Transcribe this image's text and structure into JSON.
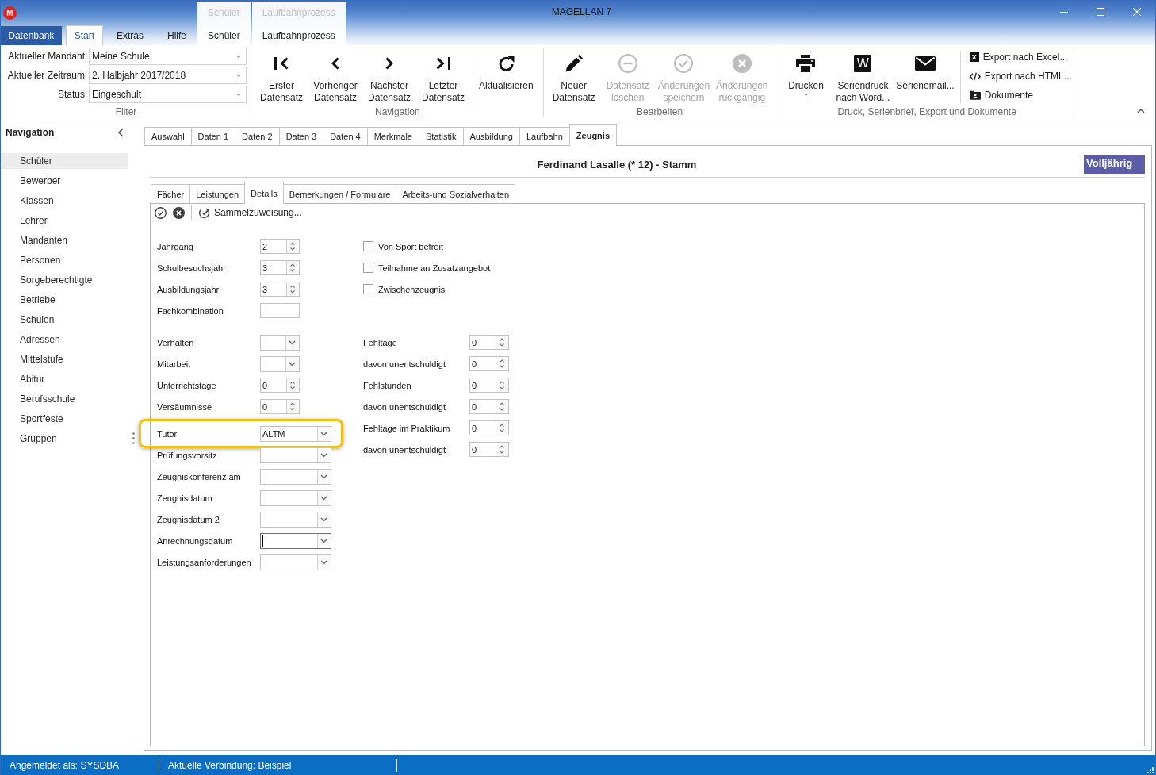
{
  "window": {
    "title": "MAGELLAN 7",
    "logo_letter": "M"
  },
  "ribbon": {
    "file_button": "Datenbank",
    "tabs": [
      {
        "label": "Start",
        "selected": true
      },
      {
        "label": "Extras",
        "selected": false
      },
      {
        "label": "Hilfe",
        "selected": false
      }
    ],
    "context_groups": [
      {
        "header": "Schüler",
        "tabs": [
          {
            "label": "Schüler",
            "selected": false
          }
        ]
      },
      {
        "header": "Laufbahnprozess",
        "tabs": [
          {
            "label": "Laufbahnprozess",
            "selected": false
          }
        ]
      }
    ],
    "filter": {
      "label": "Filter",
      "fields": [
        {
          "label": "Aktueller Mandant",
          "value": "Meine Schule"
        },
        {
          "label": "Aktueller Zeitraum",
          "value": "2. Halbjahr 2017/2018"
        },
        {
          "label": "Status",
          "value": "Eingeschult"
        }
      ]
    },
    "groups": [
      {
        "label": "Navigation",
        "sections": [
          [
            {
              "kind": "large",
              "lines": [
                "Erster",
                "Datensatz"
              ],
              "disabled": false,
              "dropdown": false
            },
            {
              "kind": "large",
              "lines": [
                "Vorheriger",
                "Datensatz"
              ],
              "disabled": false,
              "dropdown": false
            },
            {
              "kind": "large",
              "lines": [
                "Nächster",
                "Datensatz"
              ],
              "disabled": false,
              "dropdown": false
            },
            {
              "kind": "large",
              "lines": [
                "Letzter",
                "Datensatz"
              ],
              "disabled": false,
              "dropdown": false
            }
          ],
          [
            {
              "kind": "large",
              "lines": [
                "Aktualisieren"
              ],
              "disabled": false,
              "dropdown": false
            }
          ]
        ]
      },
      {
        "label": "Bearbeiten",
        "sections": [
          [
            {
              "kind": "large",
              "lines": [
                "Neuer",
                "Datensatz"
              ],
              "disabled": false,
              "dropdown": false
            },
            {
              "kind": "large",
              "lines": [
                "Datensatz",
                "löschen"
              ],
              "disabled": true,
              "dropdown": false
            },
            {
              "kind": "large",
              "lines": [
                "Änderungen",
                "speichern"
              ],
              "disabled": true,
              "dropdown": false
            },
            {
              "kind": "large",
              "lines": [
                "Änderungen",
                "rückgängig"
              ],
              "disabled": true,
              "dropdown": false
            }
          ]
        ]
      },
      {
        "label": "Druck, Serienbrief, Export und Dokumente",
        "sections": [
          [
            {
              "kind": "large",
              "lines": [
                "Drucken"
              ],
              "disabled": false,
              "dropdown": true
            },
            {
              "kind": "large",
              "lines": [
                "Seriendruck",
                "nach Word..."
              ],
              "icon_letter": "W",
              "disabled": false,
              "dropdown": false
            },
            {
              "kind": "large",
              "lines": [
                "Serienemail..."
              ],
              "disabled": false,
              "dropdown": false
            }
          ],
          [
            {
              "kind": "small",
              "label": "Export nach Excel...",
              "icon_letter": "X",
              "disabled": false
            },
            {
              "kind": "small",
              "label": "Export nach HTML...",
              "disabled": false
            },
            {
              "kind": "small",
              "label": "Dokumente",
              "disabled": false
            }
          ]
        ]
      }
    ]
  },
  "navigation": {
    "title": "Navigation",
    "items": [
      {
        "label": "Schüler",
        "selected": true
      },
      {
        "label": "Bewerber",
        "selected": false
      },
      {
        "label": "Klassen",
        "selected": false
      },
      {
        "label": "Lehrer",
        "selected": false
      },
      {
        "label": "Mandanten",
        "selected": false
      },
      {
        "label": "Personen",
        "selected": false
      },
      {
        "label": "Sorgeberechtigte",
        "selected": false
      },
      {
        "label": "Betriebe",
        "selected": false
      },
      {
        "label": "Schulen",
        "selected": false
      },
      {
        "label": "Adressen",
        "selected": false
      },
      {
        "label": "Mittelstufe",
        "selected": false
      },
      {
        "label": "Abitur",
        "selected": false
      },
      {
        "label": "Berufsschule",
        "selected": false
      },
      {
        "label": "Sportfeste",
        "selected": false
      },
      {
        "label": "Gruppen",
        "selected": false
      }
    ]
  },
  "record": {
    "tabs": [
      {
        "label": "Auswahl",
        "selected": false
      },
      {
        "label": "Daten 1",
        "selected": false
      },
      {
        "label": "Daten 2",
        "selected": false
      },
      {
        "label": "Daten 3",
        "selected": false
      },
      {
        "label": "Daten 4",
        "selected": false
      },
      {
        "label": "Merkmale",
        "selected": false
      },
      {
        "label": "Statistik",
        "selected": false
      },
      {
        "label": "Ausbildung",
        "selected": false
      },
      {
        "label": "Laufbahn",
        "selected": false
      },
      {
        "label": "Zeugnis",
        "selected": true
      }
    ],
    "title": "Ferdinand Lasalle (* 12) - Stamm",
    "badge": "Volljährig",
    "subtabs": [
      {
        "label": "Fächer",
        "selected": false
      },
      {
        "label": "Leistungen",
        "selected": false
      },
      {
        "label": "Details",
        "selected": true
      },
      {
        "label": "Bemerkungen / Formulare",
        "selected": false
      },
      {
        "label": "Arbeits-und Sozialverhalten",
        "selected": false
      }
    ],
    "toolbar": {
      "action": "Sammelzuweisung..."
    },
    "form": {
      "sections": [
        {
          "left": [
            {
              "label": "Jahrgang",
              "kind": "spin",
              "value": "2",
              "focused": false,
              "highlighted": false
            },
            {
              "label": "Schulbesuchsjahr",
              "kind": "spin",
              "value": "3",
              "focused": false,
              "highlighted": false
            },
            {
              "label": "Ausbildungsjahr",
              "kind": "spin",
              "value": "3",
              "focused": false,
              "highlighted": false
            },
            {
              "label": "Fachkombination",
              "kind": "text",
              "focused": false,
              "highlighted": false
            }
          ],
          "right": [
            {
              "label": "Von Sport befreit",
              "kind": "checkbox",
              "checked": false,
              "focused": false,
              "highlighted": false
            },
            {
              "label": "Teilnahme an Zusatzangebot",
              "kind": "checkbox",
              "checked": false,
              "focused": false,
              "highlighted": false
            },
            {
              "label": "Zwischenzeugnis",
              "kind": "checkbox",
              "checked": false,
              "focused": false,
              "highlighted": false
            }
          ]
        },
        {
          "left": [
            {
              "label": "Verhalten",
              "kind": "select",
              "focused": false,
              "highlighted": false
            },
            {
              "label": "Mitarbeit",
              "kind": "select",
              "focused": false,
              "highlighted": false
            },
            {
              "label": "Unterrichtstage",
              "kind": "spin",
              "value": "0",
              "focused": false,
              "highlighted": false
            },
            {
              "label": "Versäumnisse",
              "kind": "spin",
              "value": "0",
              "focused": false,
              "highlighted": false
            },
            {
              "label": "Tutor",
              "kind": "dropdown",
              "value": "ALTM",
              "focused": false,
              "highlighted": true
            },
            {
              "label": "Prüfungsvorsitz",
              "kind": "dropdown",
              "focused": false,
              "highlighted": false
            },
            {
              "label": "Zeugniskonferenz am",
              "kind": "dropdown",
              "focused": false,
              "highlighted": false
            },
            {
              "label": "Zeugnisdatum",
              "kind": "dropdown",
              "focused": false,
              "highlighted": false
            },
            {
              "label": "Zeugnisdatum 2",
              "kind": "dropdown",
              "focused": false,
              "highlighted": false
            },
            {
              "label": "Anrechnungsdatum",
              "kind": "dropdown",
              "focused": true,
              "highlighted": false
            },
            {
              "label": "Leistungsanforderungen",
              "kind": "dropdown",
              "focused": false,
              "highlighted": false
            }
          ],
          "right": [
            {
              "label": "Fehltage",
              "kind": "spin",
              "value": "0",
              "focused": false,
              "highlighted": false
            },
            {
              "label": "davon unentschuldigt",
              "kind": "spin",
              "value": "0",
              "focused": false,
              "highlighted": false
            },
            {
              "label": "Fehlstunden",
              "kind": "spin",
              "value": "0",
              "focused": false,
              "highlighted": false
            },
            {
              "label": "davon unentschuldigt",
              "kind": "spin",
              "value": "0",
              "focused": false,
              "highlighted": false
            },
            {
              "label": "Fehltage im Praktikum",
              "kind": "spin",
              "value": "0",
              "focused": false,
              "highlighted": false
            },
            {
              "label": "davon unentschuldigt",
              "kind": "spin",
              "value": "0",
              "focused": false,
              "highlighted": false
            }
          ]
        }
      ]
    }
  },
  "status_bar": {
    "items": [
      "Angemeldet als: SYSDBA",
      "Aktuelle Verbindung: Beispiel"
    ]
  }
}
